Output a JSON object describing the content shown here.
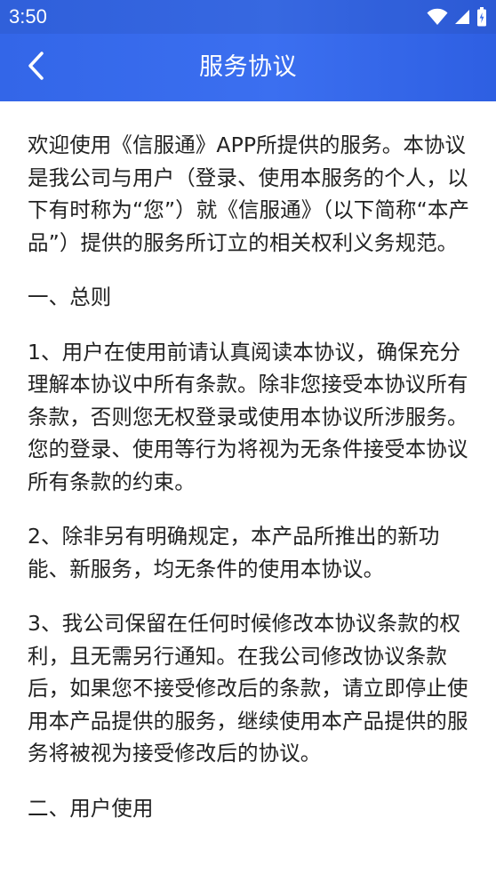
{
  "status_bar": {
    "time": "3:50",
    "icons": [
      "wifi-icon",
      "cellular-signal-icon",
      "battery-icon"
    ]
  },
  "header": {
    "title": "服务协议",
    "back_icon": "chevron-left-icon",
    "background": "#3366e8"
  },
  "content": {
    "paragraphs": [
      "欢迎使用《信服通》APP所提供的服务。本协议是我公司与用户（登录、使用本服务的个人，以下有时称为“您”）就《信服通》（以下简称“本产品”）提供的服务所订立的相关权利义务规范。",
      "一、总则",
      "1、用户在使用前请认真阅读本协议，确保充分理解本协议中所有条款。除非您接受本协议所有条款，否则您无权登录或使用本协议所涉服务。您的登录、使用等行为将视为无条件接受本协议所有条款的约束。",
      "2、除非另有明确规定，本产品所推出的新功能、新服务，均无条件的使用本协议。",
      "3、我公司保留在任何时候修改本协议条款的权利，且无需另行通知。在我公司修改协议条款后，如果您不接受修改后的条款，请立即停止使用本产品提供的服务，继续使用本产品提供的服务将被视为接受修改后的协议。",
      "二、用户使用"
    ]
  }
}
